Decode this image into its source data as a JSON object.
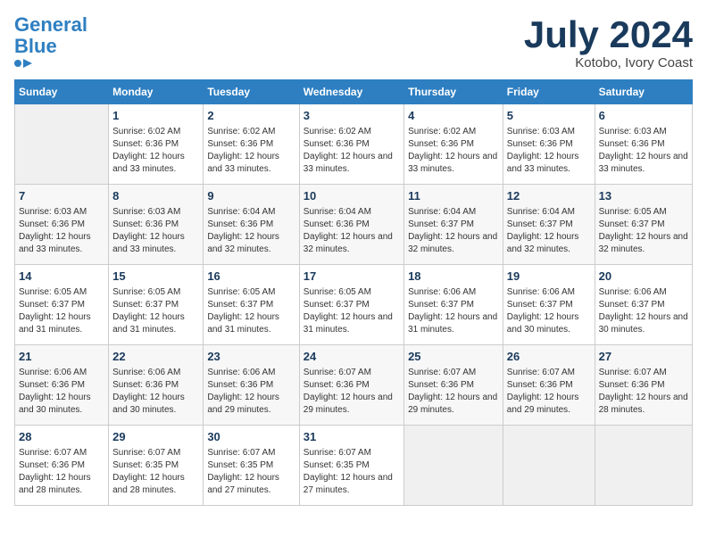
{
  "header": {
    "logo_line1": "General",
    "logo_line2": "Blue",
    "month": "July 2024",
    "location": "Kotobo, Ivory Coast"
  },
  "days_of_week": [
    "Sunday",
    "Monday",
    "Tuesday",
    "Wednesday",
    "Thursday",
    "Friday",
    "Saturday"
  ],
  "weeks": [
    [
      {
        "day": "",
        "sunrise": "",
        "sunset": "",
        "daylight": ""
      },
      {
        "day": "1",
        "sunrise": "6:02 AM",
        "sunset": "6:36 PM",
        "daylight": "12 hours and 33 minutes."
      },
      {
        "day": "2",
        "sunrise": "6:02 AM",
        "sunset": "6:36 PM",
        "daylight": "12 hours and 33 minutes."
      },
      {
        "day": "3",
        "sunrise": "6:02 AM",
        "sunset": "6:36 PM",
        "daylight": "12 hours and 33 minutes."
      },
      {
        "day": "4",
        "sunrise": "6:02 AM",
        "sunset": "6:36 PM",
        "daylight": "12 hours and 33 minutes."
      },
      {
        "day": "5",
        "sunrise": "6:03 AM",
        "sunset": "6:36 PM",
        "daylight": "12 hours and 33 minutes."
      },
      {
        "day": "6",
        "sunrise": "6:03 AM",
        "sunset": "6:36 PM",
        "daylight": "12 hours and 33 minutes."
      }
    ],
    [
      {
        "day": "7",
        "sunrise": "6:03 AM",
        "sunset": "6:36 PM",
        "daylight": "12 hours and 33 minutes."
      },
      {
        "day": "8",
        "sunrise": "6:03 AM",
        "sunset": "6:36 PM",
        "daylight": "12 hours and 33 minutes."
      },
      {
        "day": "9",
        "sunrise": "6:04 AM",
        "sunset": "6:36 PM",
        "daylight": "12 hours and 32 minutes."
      },
      {
        "day": "10",
        "sunrise": "6:04 AM",
        "sunset": "6:36 PM",
        "daylight": "12 hours and 32 minutes."
      },
      {
        "day": "11",
        "sunrise": "6:04 AM",
        "sunset": "6:37 PM",
        "daylight": "12 hours and 32 minutes."
      },
      {
        "day": "12",
        "sunrise": "6:04 AM",
        "sunset": "6:37 PM",
        "daylight": "12 hours and 32 minutes."
      },
      {
        "day": "13",
        "sunrise": "6:05 AM",
        "sunset": "6:37 PM",
        "daylight": "12 hours and 32 minutes."
      }
    ],
    [
      {
        "day": "14",
        "sunrise": "6:05 AM",
        "sunset": "6:37 PM",
        "daylight": "12 hours and 31 minutes."
      },
      {
        "day": "15",
        "sunrise": "6:05 AM",
        "sunset": "6:37 PM",
        "daylight": "12 hours and 31 minutes."
      },
      {
        "day": "16",
        "sunrise": "6:05 AM",
        "sunset": "6:37 PM",
        "daylight": "12 hours and 31 minutes."
      },
      {
        "day": "17",
        "sunrise": "6:05 AM",
        "sunset": "6:37 PM",
        "daylight": "12 hours and 31 minutes."
      },
      {
        "day": "18",
        "sunrise": "6:06 AM",
        "sunset": "6:37 PM",
        "daylight": "12 hours and 31 minutes."
      },
      {
        "day": "19",
        "sunrise": "6:06 AM",
        "sunset": "6:37 PM",
        "daylight": "12 hours and 30 minutes."
      },
      {
        "day": "20",
        "sunrise": "6:06 AM",
        "sunset": "6:37 PM",
        "daylight": "12 hours and 30 minutes."
      }
    ],
    [
      {
        "day": "21",
        "sunrise": "6:06 AM",
        "sunset": "6:36 PM",
        "daylight": "12 hours and 30 minutes."
      },
      {
        "day": "22",
        "sunrise": "6:06 AM",
        "sunset": "6:36 PM",
        "daylight": "12 hours and 30 minutes."
      },
      {
        "day": "23",
        "sunrise": "6:06 AM",
        "sunset": "6:36 PM",
        "daylight": "12 hours and 29 minutes."
      },
      {
        "day": "24",
        "sunrise": "6:07 AM",
        "sunset": "6:36 PM",
        "daylight": "12 hours and 29 minutes."
      },
      {
        "day": "25",
        "sunrise": "6:07 AM",
        "sunset": "6:36 PM",
        "daylight": "12 hours and 29 minutes."
      },
      {
        "day": "26",
        "sunrise": "6:07 AM",
        "sunset": "6:36 PM",
        "daylight": "12 hours and 29 minutes."
      },
      {
        "day": "27",
        "sunrise": "6:07 AM",
        "sunset": "6:36 PM",
        "daylight": "12 hours and 28 minutes."
      }
    ],
    [
      {
        "day": "28",
        "sunrise": "6:07 AM",
        "sunset": "6:36 PM",
        "daylight": "12 hours and 28 minutes."
      },
      {
        "day": "29",
        "sunrise": "6:07 AM",
        "sunset": "6:35 PM",
        "daylight": "12 hours and 28 minutes."
      },
      {
        "day": "30",
        "sunrise": "6:07 AM",
        "sunset": "6:35 PM",
        "daylight": "12 hours and 27 minutes."
      },
      {
        "day": "31",
        "sunrise": "6:07 AM",
        "sunset": "6:35 PM",
        "daylight": "12 hours and 27 minutes."
      },
      {
        "day": "",
        "sunrise": "",
        "sunset": "",
        "daylight": ""
      },
      {
        "day": "",
        "sunrise": "",
        "sunset": "",
        "daylight": ""
      },
      {
        "day": "",
        "sunrise": "",
        "sunset": "",
        "daylight": ""
      }
    ]
  ]
}
